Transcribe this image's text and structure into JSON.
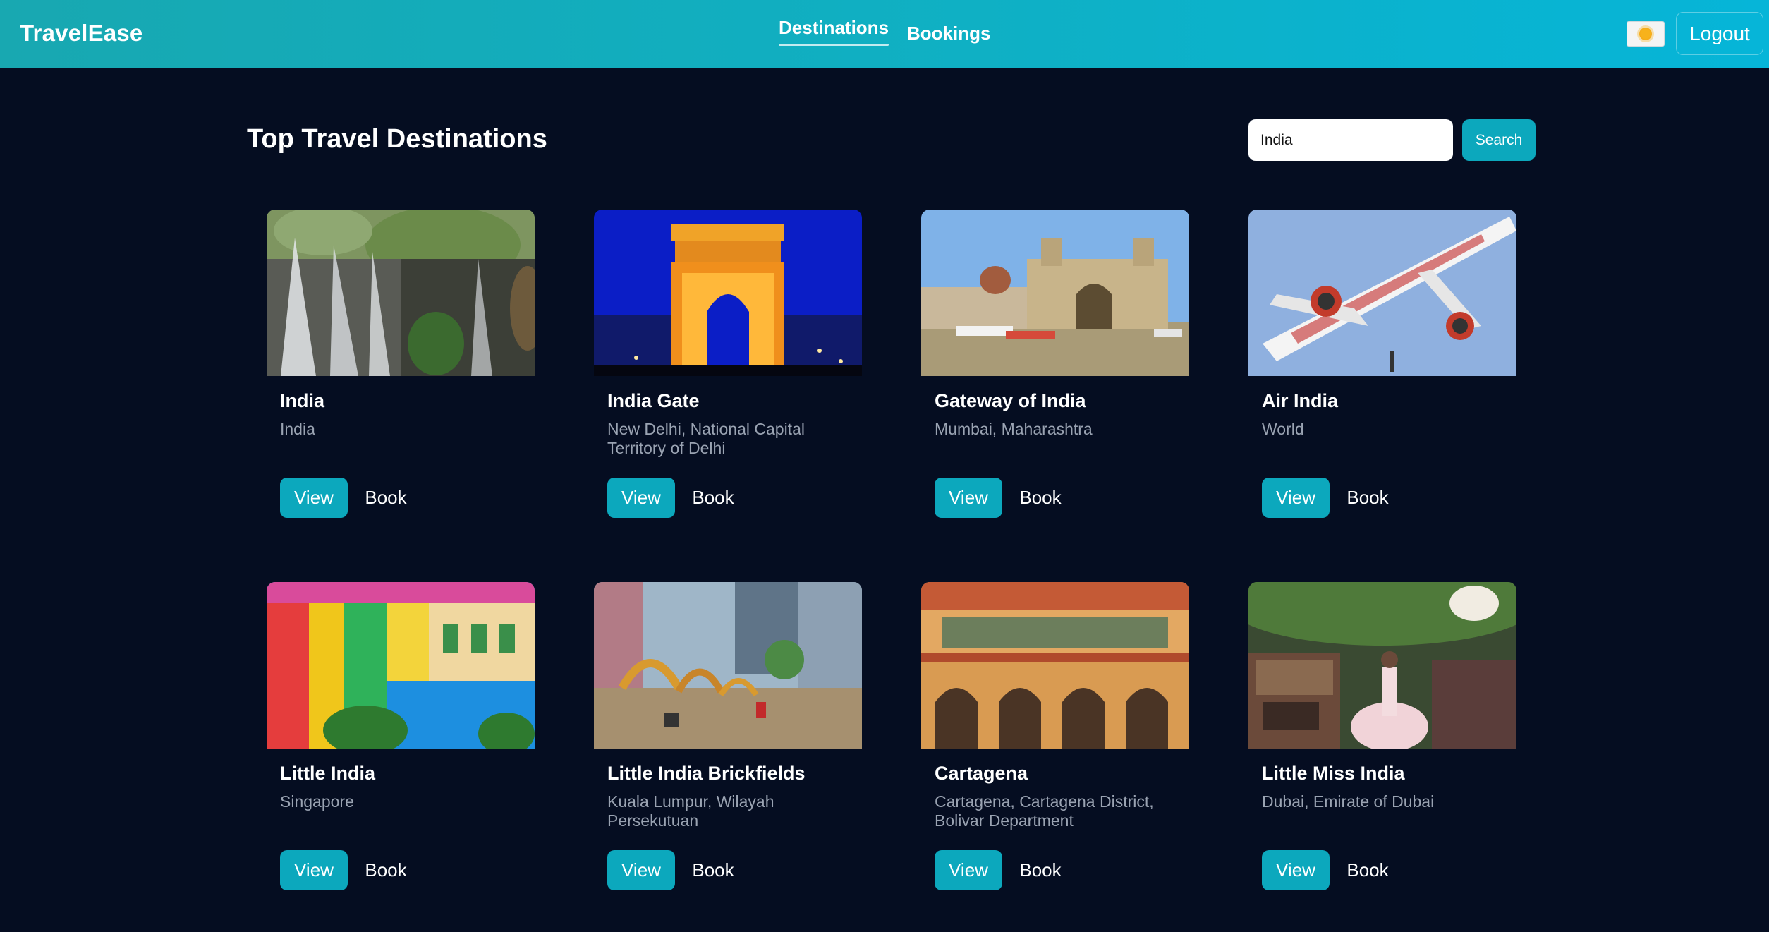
{
  "app": {
    "brand": "TravelEase"
  },
  "nav": {
    "items": [
      {
        "label": "Destinations",
        "active": true
      },
      {
        "label": "Bookings",
        "active": false
      }
    ],
    "theme_icon": "sun-icon",
    "logout_label": "Logout"
  },
  "main": {
    "title": "Top Travel Destinations",
    "search": {
      "value": "India",
      "button_label": "Search"
    }
  },
  "colors": {
    "accent": "#0ca8bd",
    "background": "#050d21",
    "muted_text": "#9aa3b2"
  },
  "destinations": [
    {
      "name": "India",
      "location": "India",
      "view_label": "View",
      "book_label": "Book"
    },
    {
      "name": "India Gate",
      "location": "New Delhi, National Capital Territory of Delhi",
      "view_label": "View",
      "book_label": "Book"
    },
    {
      "name": "Gateway of India",
      "location": "Mumbai, Maharashtra",
      "view_label": "View",
      "book_label": "Book"
    },
    {
      "name": "Air India",
      "location": "World",
      "view_label": "View",
      "book_label": "Book"
    },
    {
      "name": "Little India",
      "location": "Singapore",
      "view_label": "View",
      "book_label": "Book"
    },
    {
      "name": "Little India Brickfields",
      "location": "Kuala Lumpur, Wilayah Persekutuan",
      "view_label": "View",
      "book_label": "Book"
    },
    {
      "name": "Cartagena",
      "location": "Cartagena, Cartagena District, Bolivar Department",
      "view_label": "View",
      "book_label": "Book"
    },
    {
      "name": "Little Miss India",
      "location": "Dubai, Emirate of Dubai",
      "view_label": "View",
      "book_label": "Book"
    }
  ]
}
